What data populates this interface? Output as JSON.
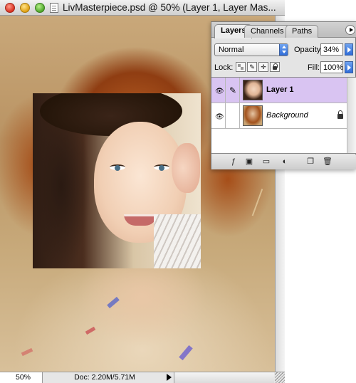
{
  "window": {
    "title": "LivMasterpiece.psd @ 50% (Layer 1, Layer Mas..."
  },
  "statusbar": {
    "zoom": "50%",
    "doc_size": "Doc: 2.20M/5.71M"
  },
  "layers_palette": {
    "tabs": [
      {
        "label": "Layers"
      },
      {
        "label": "Channels"
      },
      {
        "label": "Paths"
      }
    ],
    "active_tab": "Layers",
    "blend_mode": "Normal",
    "opacity_label": "Opacity:",
    "opacity_value": "34%",
    "lock_label": "Lock:",
    "fill_label": "Fill:",
    "fill_value": "100%",
    "layers": [
      {
        "name": "Layer 1",
        "selected": true,
        "visible": true
      },
      {
        "name": "Background",
        "selected": false,
        "visible": true,
        "locked": true
      }
    ],
    "icons": {
      "visibility": "eye-icon",
      "brush": "brush-icon",
      "lock": "lock-icon",
      "effects": "layer-style-icon",
      "mask": "add-mask-icon",
      "group": "folder-icon",
      "adjustment": "adjustment-layer-icon",
      "new_layer": "new-layer-icon",
      "delete": "trash-icon"
    },
    "selected_color": "#d9c4f2"
  }
}
